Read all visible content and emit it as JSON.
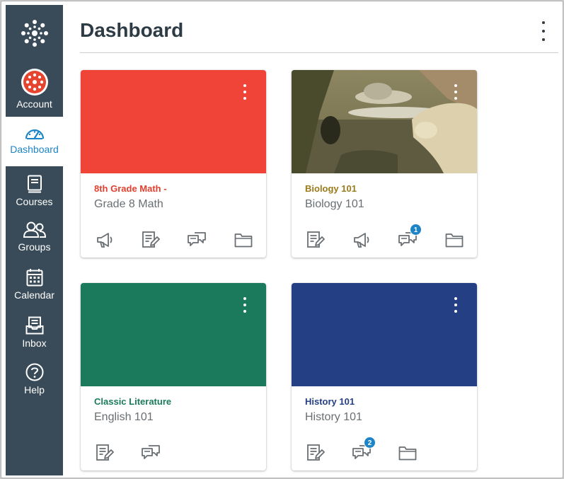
{
  "sidebar": {
    "items": [
      {
        "label": "Account",
        "icon": "account-avatar-icon"
      },
      {
        "label": "Dashboard",
        "icon": "dashboard-gauge-icon"
      },
      {
        "label": "Courses",
        "icon": "courses-book-icon"
      },
      {
        "label": "Groups",
        "icon": "groups-people-icon"
      },
      {
        "label": "Calendar",
        "icon": "calendar-icon"
      },
      {
        "label": "Inbox",
        "icon": "inbox-icon"
      },
      {
        "label": "Help",
        "icon": "help-icon"
      }
    ],
    "active": "Dashboard",
    "bg_color": "#394b58",
    "active_color": "#1d84c7"
  },
  "header": {
    "title": "Dashboard"
  },
  "cards": [
    {
      "title": "8th Grade Math -",
      "subtitle": "Grade 8 Math",
      "color": "#ef4437",
      "actions": [
        "announcements-icon",
        "assignments-icon",
        "discussions-icon",
        "files-icon"
      ]
    },
    {
      "title": "Biology 101",
      "subtitle": "Biology 101",
      "color": "#9b7a1a",
      "hero": "image",
      "actions": [
        "assignments-icon",
        "announcements-icon",
        "discussions-icon",
        "files-icon"
      ],
      "discussion_badge": "1"
    },
    {
      "title": "Classic Literature",
      "subtitle": "English 101",
      "color": "#1b7a5c",
      "actions": [
        "assignments-icon",
        "discussions-icon"
      ]
    },
    {
      "title": "History 101",
      "subtitle": "History 101",
      "color": "#243f84",
      "actions": [
        "assignments-icon",
        "discussions-icon",
        "files-icon"
      ],
      "discussion_badge": "2"
    }
  ]
}
